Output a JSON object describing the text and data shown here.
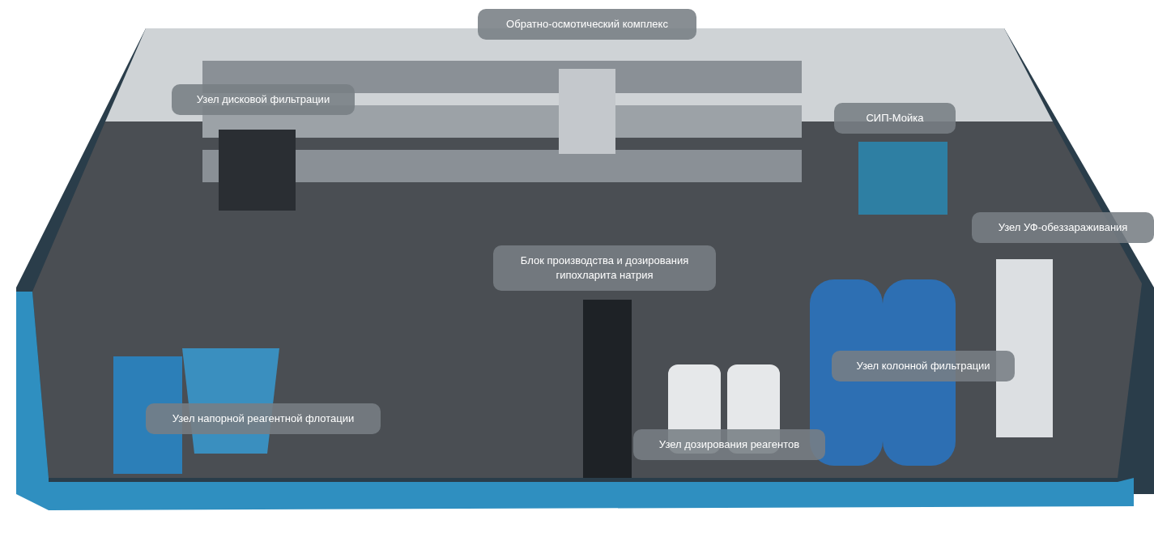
{
  "callouts": [
    {
      "text": "Обратно-осмотический комплекс"
    },
    {
      "text": "Узел дисковой фильтрации"
    },
    {
      "text": "СИП-Мойка"
    },
    {
      "text": "Узел УФ-обеззараживания"
    },
    {
      "text": "Блок производства и дозирования гипохларита натрия"
    },
    {
      "text": "Узел колонной фильтрации"
    },
    {
      "text": "Узел напорной реагентной флотации"
    },
    {
      "text": "Узел дозирования реагентов"
    }
  ]
}
